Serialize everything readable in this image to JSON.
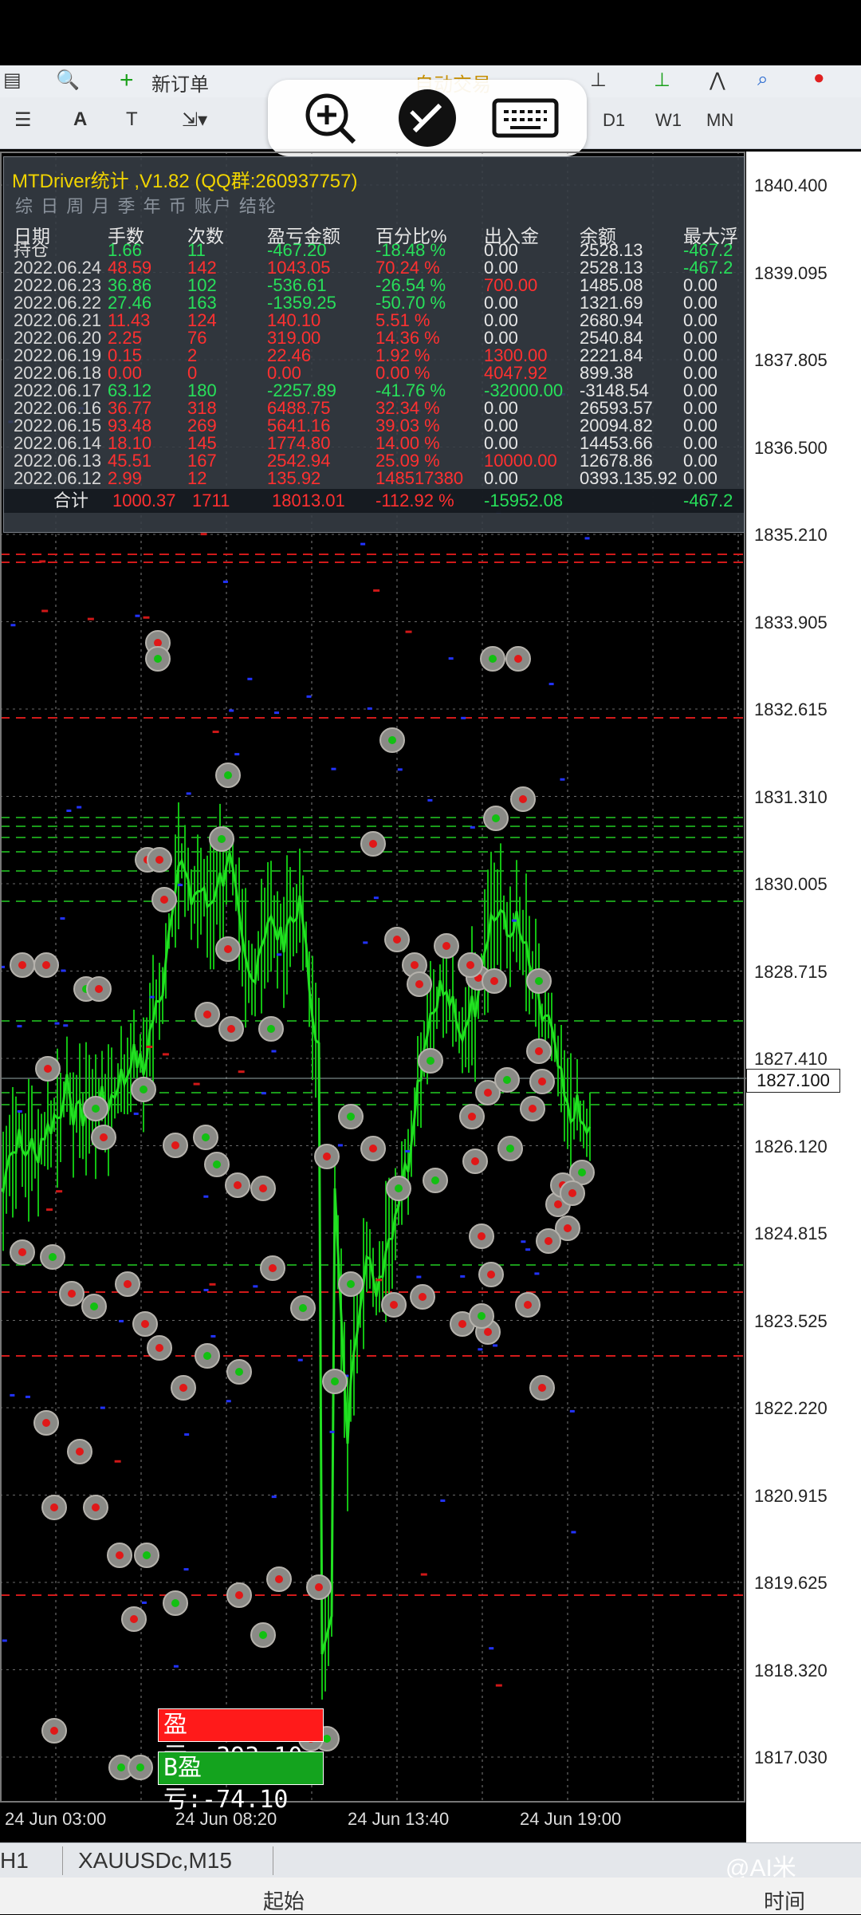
{
  "toolbar": {
    "new_order_label": "新订单",
    "auto_trading_label": "自动交易",
    "timeframes": [
      "D1",
      "W1",
      "MN"
    ]
  },
  "panel": {
    "title": "MTDriver统计 ,V1.82 (QQ群:260937757)",
    "tabs": "综 日 周 月 季 年 币 账户 结轮",
    "headers": [
      "日期",
      "手数",
      "次数",
      "盈亏金额",
      "百分比%",
      "出入金",
      "余额",
      "最大浮"
    ],
    "rows": [
      {
        "date": "持仓",
        "lots": "1.66",
        "count": "11",
        "pnl": "-467.20",
        "pct": "-18.48 %",
        "inout": "0.00",
        "bal": "2528.13",
        "maxf": "-467.2"
      },
      {
        "date": "2022.06.24",
        "lots": "48.59",
        "count": "142",
        "pnl": "1043.05",
        "pct": "70.24 %",
        "inout": "0.00",
        "bal": "2528.13",
        "maxf": "-467.2"
      },
      {
        "date": "2022.06.23",
        "lots": "36.86",
        "count": "102",
        "pnl": "-536.61",
        "pct": "-26.54 %",
        "inout": "700.00",
        "bal": "1485.08",
        "maxf": "0.00"
      },
      {
        "date": "2022.06.22",
        "lots": "27.46",
        "count": "163",
        "pnl": "-1359.25",
        "pct": "-50.70 %",
        "inout": "0.00",
        "bal": "1321.69",
        "maxf": "0.00"
      },
      {
        "date": "2022.06.21",
        "lots": "11.43",
        "count": "124",
        "pnl": "140.10",
        "pct": "5.51 %",
        "inout": "0.00",
        "bal": "2680.94",
        "maxf": "0.00"
      },
      {
        "date": "2022.06.20",
        "lots": "2.25",
        "count": "76",
        "pnl": "319.00",
        "pct": "14.36 %",
        "inout": "0.00",
        "bal": "2540.84",
        "maxf": "0.00"
      },
      {
        "date": "2022.06.19",
        "lots": "0.15",
        "count": "2",
        "pnl": "22.46",
        "pct": "1.92 %",
        "inout": "1300.00",
        "bal": "2221.84",
        "maxf": "0.00"
      },
      {
        "date": "2022.06.18",
        "lots": "0.00",
        "count": "0",
        "pnl": "0.00",
        "pct": "0.00 %",
        "inout": "4047.92",
        "bal": "899.38",
        "maxf": "0.00"
      },
      {
        "date": "2022.06.17",
        "lots": "63.12",
        "count": "180",
        "pnl": "-2257.89",
        "pct": "-41.76 %",
        "inout": "-32000.00",
        "bal": "-3148.54",
        "maxf": "0.00"
      },
      {
        "date": "2022.06.16",
        "lots": "36.77",
        "count": "318",
        "pnl": "6488.75",
        "pct": "32.34 %",
        "inout": "0.00",
        "bal": "26593.57",
        "maxf": "0.00"
      },
      {
        "date": "2022.06.15",
        "lots": "93.48",
        "count": "269",
        "pnl": "5641.16",
        "pct": "39.03 %",
        "inout": "0.00",
        "bal": "20094.82",
        "maxf": "0.00"
      },
      {
        "date": "2022.06.14",
        "lots": "18.10",
        "count": "145",
        "pnl": "1774.80",
        "pct": "14.00 %",
        "inout": "0.00",
        "bal": "14453.66",
        "maxf": "0.00"
      },
      {
        "date": "2022.06.13",
        "lots": "45.51",
        "count": "167",
        "pnl": "2542.94",
        "pct": "25.09 %",
        "inout": "10000.00",
        "bal": "12678.86",
        "maxf": "0.00"
      },
      {
        "date": "2022.06.12",
        "lots": "2.99",
        "count": "12",
        "pnl": "135.92",
        "pct": "148517380",
        "inout": "0.00",
        "bal": "0393.135.92",
        "maxf": "0.00"
      }
    ],
    "total": {
      "label": "合计",
      "lots": "1000.37",
      "count": "1711",
      "pnl": "18013.01",
      "pct": "-112.92 %",
      "inout": "-15952.08",
      "maxf": "-467.2"
    }
  },
  "price_axis": [
    "1840.400",
    "1839.095",
    "1837.805",
    "1836.500",
    "1835.210",
    "1833.905",
    "1832.615",
    "1831.310",
    "1830.005",
    "1828.715",
    "1827.410",
    "1826.120",
    "1824.815",
    "1823.525",
    "1822.220",
    "1820.915",
    "1819.625",
    "1818.320",
    "1817.030"
  ],
  "current_price": "1827.100",
  "time_axis": [
    "24 Jun 03:00",
    "24 Jun 08:20",
    "24 Jun 13:40",
    "24 Jun 19:00"
  ],
  "pnl_boxes": {
    "red": "盈亏:-393.10",
    "green": "B盈亏:-74.10"
  },
  "bottom_tabs": [
    "H1",
    "XAUUSDc,M15"
  ],
  "status": {
    "start": "起始",
    "time": "时间"
  },
  "watermark": "@AI米",
  "colors": {
    "up": "#00ff00",
    "down": "#ff3030",
    "accent": "#f1d400"
  }
}
